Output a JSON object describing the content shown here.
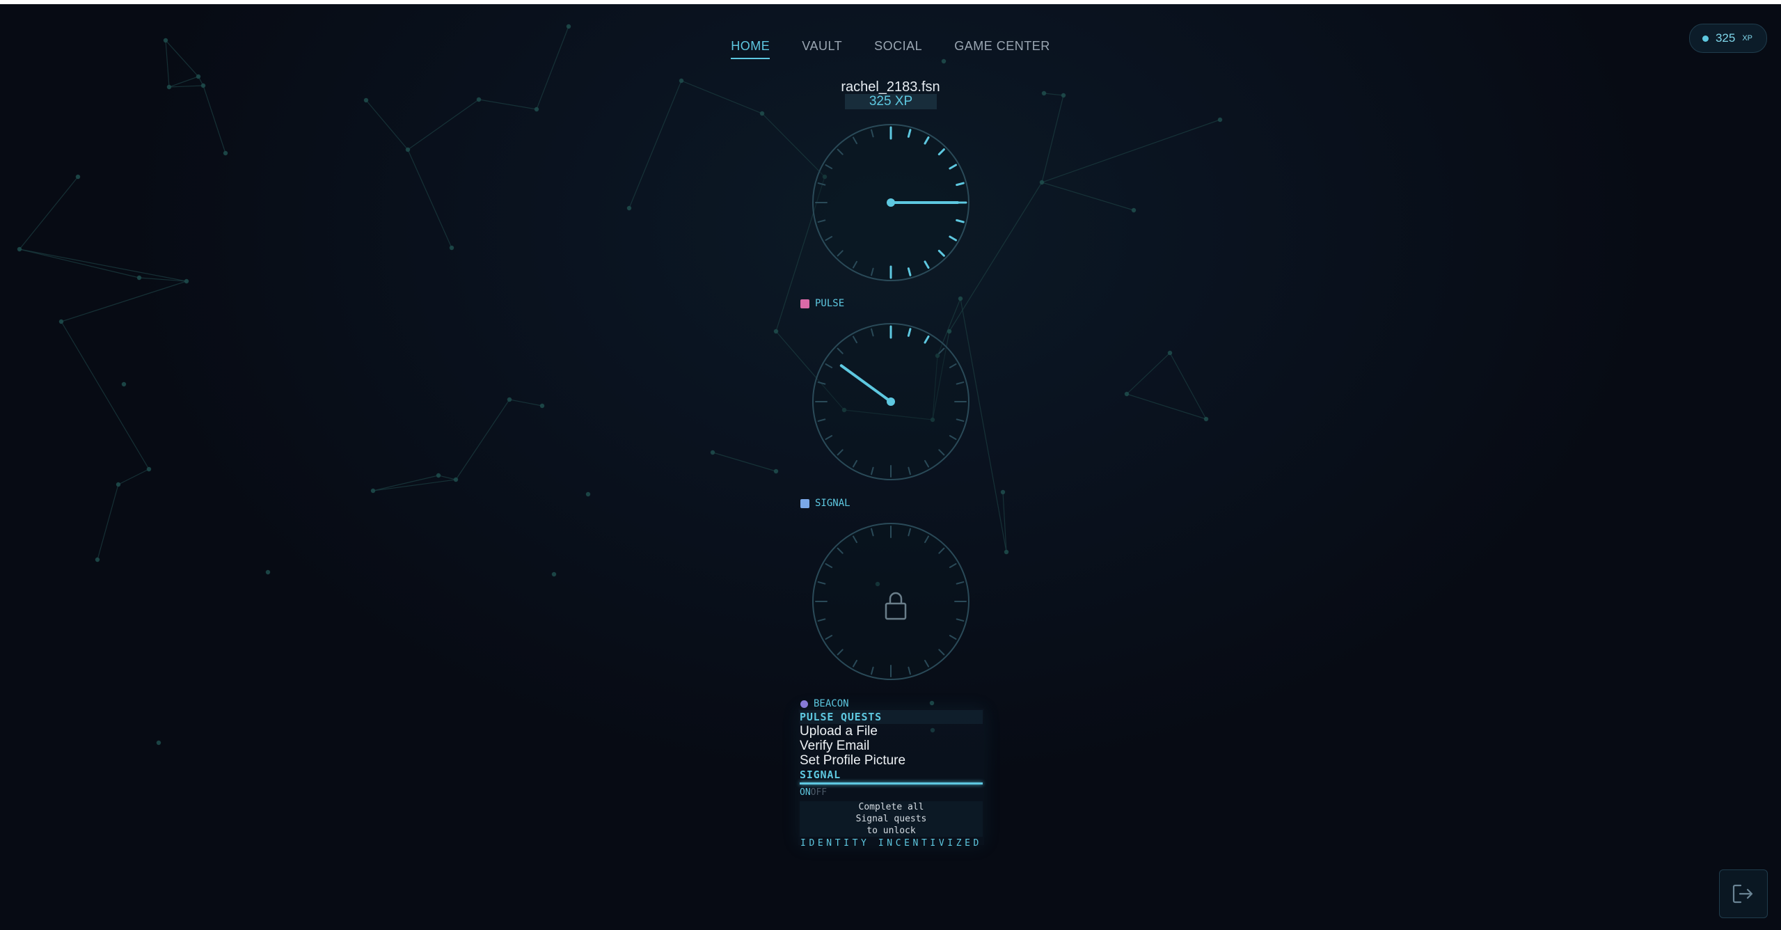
{
  "nav": {
    "items": [
      {
        "label": "HOME",
        "active": true
      },
      {
        "label": "VAULT",
        "active": false
      },
      {
        "label": "SOCIAL",
        "active": false
      },
      {
        "label": "GAME CENTER",
        "active": false
      }
    ]
  },
  "xp_chip": {
    "value": "325",
    "unit": "XP"
  },
  "profile": {
    "username": "rachel_2183.fsn",
    "xp": "325 XP"
  },
  "gauges": [
    {
      "label": "",
      "state": "active",
      "needle_fraction": 0.25,
      "lit_ticks": 12
    },
    {
      "label": "PULSE",
      "badge_color": "#d96aa8",
      "state": "active",
      "needle_fraction": 0.85,
      "lit_ticks": 2
    },
    {
      "label": "SIGNAL",
      "badge_color": "#7aa8e8",
      "state": "locked",
      "icon": "lock-icon"
    }
  ],
  "beacon_label": "BEACON",
  "beacon_badge_color": "#8a7ad8",
  "quests": {
    "pulse_header": "PULSE QUESTS",
    "items": [
      "Upload a File",
      "Verify Email",
      "Set Profile Picture"
    ],
    "signal_header": "SIGNAL",
    "toggle_on": "ON",
    "toggle_off": "OFF",
    "lock_message": [
      "Complete all",
      "Signal quests",
      "to unlock"
    ],
    "footer": "IDENTITY INCENTIVIZED"
  },
  "colors": {
    "accent": "#5ec8e0",
    "background": "#070b14",
    "dim": "#2a4a58"
  },
  "icons": {
    "logout": "logout-icon"
  }
}
